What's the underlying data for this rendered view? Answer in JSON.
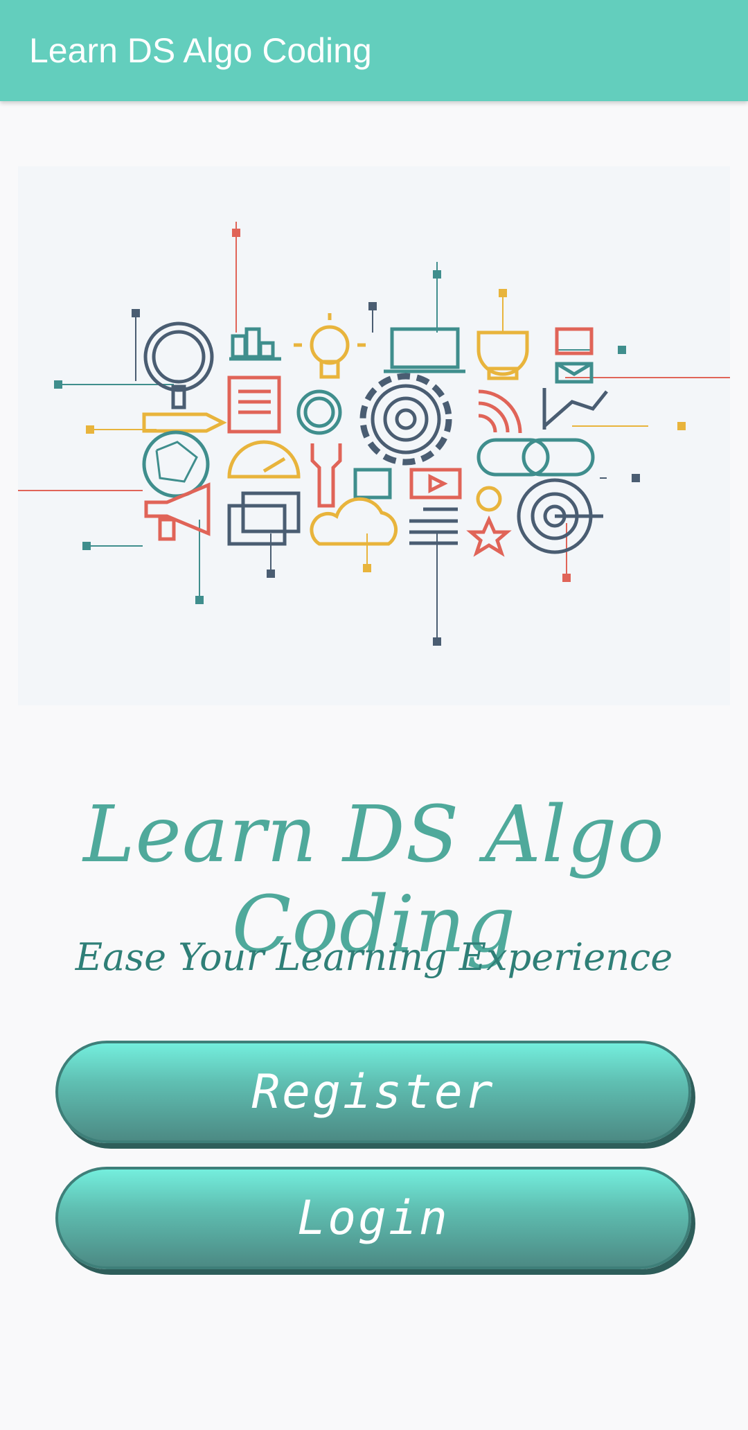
{
  "appbar": {
    "title": "Learn DS Algo Coding"
  },
  "hero": {
    "image": "tech-icons-illustration"
  },
  "main": {
    "title": "Learn DS Algo Coding",
    "tagline": "Ease Your Learning Experience"
  },
  "buttons": {
    "register_label": "Register",
    "login_label": "Login"
  },
  "colors": {
    "appbar": "#63cebd",
    "accent": "#4fa99b",
    "button_top": "#74eedd",
    "button_bottom": "#4c8a84"
  }
}
